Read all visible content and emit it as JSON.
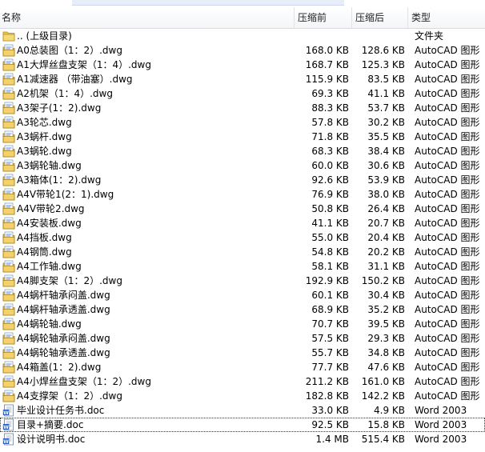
{
  "columns": {
    "name": "名称",
    "before": "压缩前",
    "after": "压缩后",
    "type": "类型"
  },
  "rows": [
    {
      "icon": "folder-up-icon",
      "name": ".. (上级目录)",
      "before": "",
      "after": "",
      "type": "文件夹"
    },
    {
      "icon": "dwg-file-icon",
      "name": "A0总装图（1：2）.dwg",
      "before": "168.0 KB",
      "after": "128.6 KB",
      "type": "AutoCAD 图形"
    },
    {
      "icon": "dwg-file-icon",
      "name": "A1大焊丝盘支架（1：4）.dwg",
      "before": "168.7 KB",
      "after": "125.3 KB",
      "type": "AutoCAD 图形"
    },
    {
      "icon": "dwg-file-icon",
      "name": "A1减速器 （带油塞）.dwg",
      "before": "115.9 KB",
      "after": "83.5 KB",
      "type": "AutoCAD 图形"
    },
    {
      "icon": "dwg-file-icon",
      "name": "A2机架（1：4）.dwg",
      "before": "69.3 KB",
      "after": "41.1 KB",
      "type": "AutoCAD 图形"
    },
    {
      "icon": "dwg-file-icon",
      "name": "A3架子(1：2).dwg",
      "before": "88.3 KB",
      "after": "53.7 KB",
      "type": "AutoCAD 图形"
    },
    {
      "icon": "dwg-file-icon",
      "name": "A3轮芯.dwg",
      "before": "57.8 KB",
      "after": "30.2 KB",
      "type": "AutoCAD 图形"
    },
    {
      "icon": "dwg-file-icon",
      "name": "A3蜗杆.dwg",
      "before": "71.8 KB",
      "after": "35.5 KB",
      "type": "AutoCAD 图形"
    },
    {
      "icon": "dwg-file-icon",
      "name": "A3蜗轮.dwg",
      "before": "68.3 KB",
      "after": "38.4 KB",
      "type": "AutoCAD 图形"
    },
    {
      "icon": "dwg-file-icon",
      "name": "A3蜗轮轴.dwg",
      "before": "60.0 KB",
      "after": "30.6 KB",
      "type": "AutoCAD 图形"
    },
    {
      "icon": "dwg-file-icon",
      "name": "A3箱体(1：2).dwg",
      "before": "92.6 KB",
      "after": "53.9 KB",
      "type": "AutoCAD 图形"
    },
    {
      "icon": "dwg-file-icon",
      "name": "A4V带轮1(2：1).dwg",
      "before": "76.9 KB",
      "after": "38.0 KB",
      "type": "AutoCAD 图形"
    },
    {
      "icon": "dwg-file-icon",
      "name": "A4V带轮2.dwg",
      "before": "50.8 KB",
      "after": "26.4 KB",
      "type": "AutoCAD 图形"
    },
    {
      "icon": "dwg-file-icon",
      "name": "A4安装板.dwg",
      "before": "41.1 KB",
      "after": "20.7 KB",
      "type": "AutoCAD 图形"
    },
    {
      "icon": "dwg-file-icon",
      "name": "A4挡板.dwg",
      "before": "55.0 KB",
      "after": "20.4 KB",
      "type": "AutoCAD 图形"
    },
    {
      "icon": "dwg-file-icon",
      "name": "A4钢筒.dwg",
      "before": "54.8 KB",
      "after": "20.2 KB",
      "type": "AutoCAD 图形"
    },
    {
      "icon": "dwg-file-icon",
      "name": "A4工作轴.dwg",
      "before": "58.1 KB",
      "after": "31.1 KB",
      "type": "AutoCAD 图形"
    },
    {
      "icon": "dwg-file-icon",
      "name": "A4脚支架（1：2）.dwg",
      "before": "192.9 KB",
      "after": "150.2 KB",
      "type": "AutoCAD 图形"
    },
    {
      "icon": "dwg-file-icon",
      "name": "A4蜗杆轴承闷盖.dwg",
      "before": "60.1 KB",
      "after": "30.4 KB",
      "type": "AutoCAD 图形"
    },
    {
      "icon": "dwg-file-icon",
      "name": "A4蜗杆轴承透盖.dwg",
      "before": "68.9 KB",
      "after": "35.2 KB",
      "type": "AutoCAD 图形"
    },
    {
      "icon": "dwg-file-icon",
      "name": "A4蜗轮轴.dwg",
      "before": "70.7 KB",
      "after": "39.5 KB",
      "type": "AutoCAD 图形"
    },
    {
      "icon": "dwg-file-icon",
      "name": "A4蜗轮轴承闷盖.dwg",
      "before": "57.5 KB",
      "after": "29.3 KB",
      "type": "AutoCAD 图形"
    },
    {
      "icon": "dwg-file-icon",
      "name": "A4蜗轮轴承透盖.dwg",
      "before": "55.7 KB",
      "after": "34.8 KB",
      "type": "AutoCAD 图形"
    },
    {
      "icon": "dwg-file-icon",
      "name": "A4箱盖(1：2).dwg",
      "before": "77.7 KB",
      "after": "47.6 KB",
      "type": "AutoCAD 图形"
    },
    {
      "icon": "dwg-file-icon",
      "name": "A4小焊丝盘支架（1：2）.dwg",
      "before": "211.2 KB",
      "after": "161.0 KB",
      "type": "AutoCAD 图形"
    },
    {
      "icon": "dwg-file-icon",
      "name": "A4支撑架（1：2）.dwg",
      "before": "182.8 KB",
      "after": "142.2 KB",
      "type": "AutoCAD 图形"
    },
    {
      "icon": "word-file-icon",
      "name": "毕业设计任务书.doc",
      "before": "33.0 KB",
      "after": "4.9 KB",
      "type": "Word 2003"
    },
    {
      "icon": "word-file-icon",
      "name": "目录+摘要.doc",
      "before": "92.5 KB",
      "after": "15.8 KB",
      "type": "Word 2003",
      "selected": true
    },
    {
      "icon": "word-file-icon",
      "name": "设计说明书.doc",
      "before": "1.4 MB",
      "after": "515.4 KB",
      "type": "Word 2003"
    }
  ]
}
